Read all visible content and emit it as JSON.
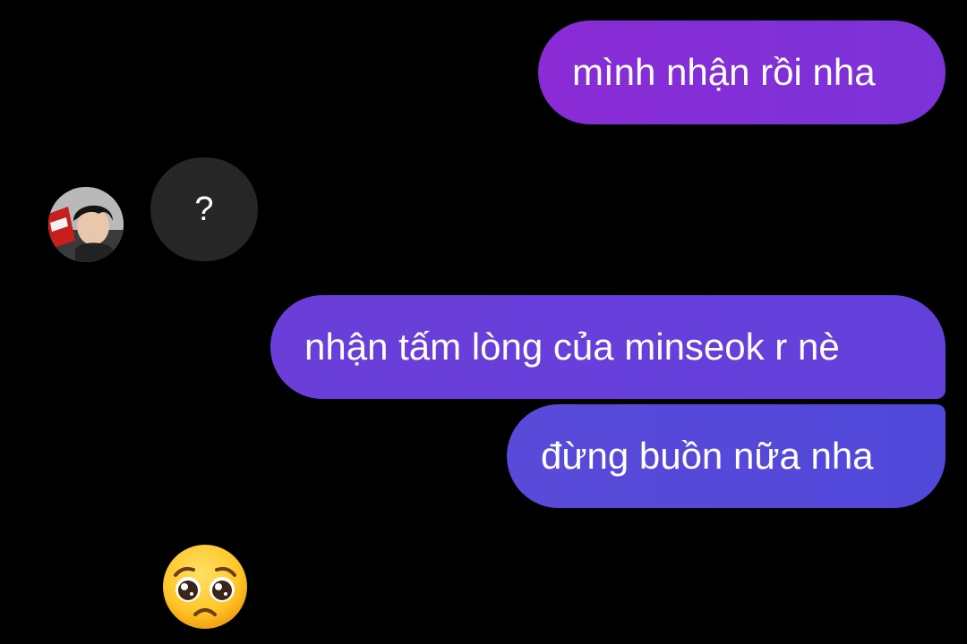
{
  "messages": {
    "outgoing": [
      {
        "text": "mình nhận rồi nha"
      },
      {
        "text": "nhận tấm lòng của minseok r nè"
      },
      {
        "text": "đừng buồn nữa nha"
      }
    ],
    "incoming": [
      {
        "text": "?"
      }
    ],
    "reaction_emoji": "pleading-face-emoji"
  },
  "colors": {
    "background": "#000000",
    "outgoing_bubble_1": "#8a2bd6",
    "outgoing_bubble_2": "#6b3ed9",
    "outgoing_bubble_3": "#5a4ad9",
    "incoming_bubble": "#262626",
    "text": "#ffffff"
  }
}
